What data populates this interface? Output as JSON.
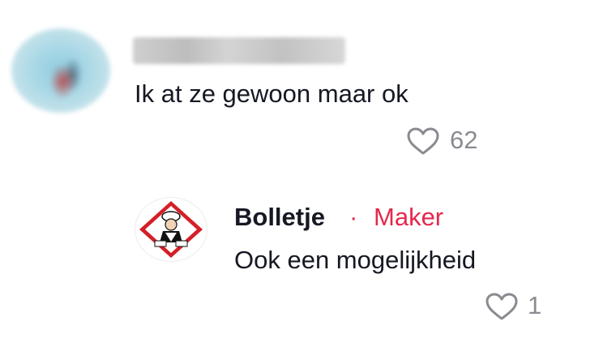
{
  "comment": {
    "author_avatar_icon": "blurred-user-avatar",
    "text": "Ik at ze gewoon maar ok",
    "likes": "62"
  },
  "reply": {
    "author": "Bolletje",
    "separator": "·",
    "badge": "Maker",
    "text": "Ook een mogelijkheid",
    "likes": "1",
    "logo_icon": "bolletje-baker-logo"
  },
  "colors": {
    "text": "#161823",
    "muted": "#8a8b91",
    "maker": "#e5284d",
    "logo_red": "#d41f26"
  }
}
